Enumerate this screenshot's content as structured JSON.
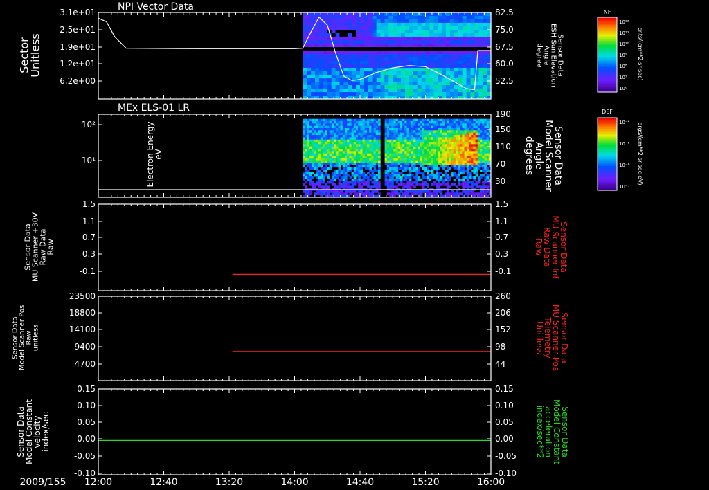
{
  "figure": {
    "date_label": "2009/155",
    "time_axis": {
      "start": "12:00",
      "end": "16:00",
      "tick_labels": [
        "12:00",
        "12:40",
        "13:20",
        "14:00",
        "14:40",
        "15:20",
        "16:00"
      ]
    }
  },
  "colorbars": [
    {
      "tag": "NF",
      "unit": "cnts/(cm**2-sr-sec)",
      "ticks": [
        "10¹²",
        "10¹¹",
        "10¹⁰",
        "10⁹",
        "10⁸",
        "10⁷",
        "10⁶"
      ]
    },
    {
      "tag": "DEF",
      "unit": "ergs/(cm**2-sr-sec-eV)",
      "ticks": [
        "10⁻⁴",
        "10⁻⁵",
        "10⁻⁶",
        "10⁻⁷"
      ]
    }
  ],
  "chart_data": [
    {
      "type": "heatmap",
      "title": "NPI Vector Data",
      "left_axis": {
        "label_lines": [
          "Sector",
          "Unitless"
        ],
        "ticks": [
          "3.1e+01",
          "2.5e+01",
          "1.9e+01",
          "1.2e+01",
          "6.2e+00"
        ],
        "color": "#ffffff"
      },
      "right_axis": {
        "label_lines": [
          "Sensor Data",
          "ESH Sun Elevation",
          "Angle",
          "degree"
        ],
        "ticks": [
          "82.5",
          "75.0",
          "67.5",
          "60.0",
          "52.5"
        ],
        "range": [
          45,
          82.5
        ],
        "color": "#ffffff"
      },
      "heatmap_time_range": [
        "14:05",
        "16:00"
      ],
      "overlay_line": {
        "axis": "right",
        "color": "#ffffff",
        "x": [
          "12:00",
          "12:05",
          "12:10",
          "12:17",
          "13:00",
          "14:00",
          "14:05",
          "14:10",
          "14:15",
          "14:20",
          "14:25",
          "14:30",
          "14:35",
          "14:40",
          "14:50",
          "15:00",
          "15:10",
          "15:20",
          "15:30",
          "15:40",
          "15:45",
          "15:50",
          "15:52",
          "16:00"
        ],
        "y": [
          80.0,
          78.5,
          72.0,
          67.0,
          66.8,
          66.8,
          67.0,
          74.0,
          80.5,
          77.0,
          65.0,
          55.0,
          53.0,
          53.5,
          56.5,
          58.5,
          59.5,
          59.0,
          55.5,
          51.5,
          49.5,
          49.0,
          66.0,
          66.0
        ]
      }
    },
    {
      "type": "heatmap",
      "title": "MEx ELS-01 LR",
      "left_axis": {
        "label_lines": [
          "Electron Energy",
          "eV"
        ],
        "ticks": [
          "10²",
          "10¹"
        ],
        "scale": "log",
        "color": "#ffffff"
      },
      "right_axis": {
        "label_lines": [
          "Sensor Data",
          "Model Scanner",
          "Angle",
          "degrees"
        ],
        "ticks": [
          "190",
          "150",
          "110",
          "70",
          "30"
        ],
        "range": [
          -5,
          190
        ],
        "color": "#ffffff"
      },
      "heatmap_time_range": [
        "14:05",
        "16:00"
      ],
      "overlay_line": {
        "axis": "right",
        "color": "#ffffff",
        "x": [
          "12:00",
          "16:00"
        ],
        "y": [
          0,
          0
        ]
      }
    },
    {
      "type": "line",
      "left_axis": {
        "label_lines": [
          "Sensor Data",
          "MU Scanner +30V",
          "Raw Data",
          "Raw"
        ],
        "ticks": [
          "1.5",
          "1.1",
          "0.7",
          "0.3",
          "-0.1"
        ],
        "range": [
          -0.35,
          1.5
        ],
        "color": "#ffffff"
      },
      "right_axis": {
        "label_lines": [
          "Sensor Data",
          "MU Scanner Inf",
          "Raw Data",
          "Raw"
        ],
        "ticks": [
          "1.5",
          "1.1",
          "0.7",
          "0.3",
          "-0.1"
        ],
        "range": [
          -0.35,
          1.5
        ],
        "color": "#ff2020"
      },
      "series": [
        {
          "axis": "right",
          "color": "#ff2020",
          "x": [
            "13:22",
            "16:00"
          ],
          "y": [
            0.0,
            0.0
          ]
        }
      ]
    },
    {
      "type": "line",
      "left_axis": {
        "label_lines": [
          "Sensor Data",
          "Model Scanner Pos",
          "Raw",
          "unitless"
        ],
        "ticks": [
          "23500",
          "18800",
          "14100",
          "9400",
          "4700"
        ],
        "range": [
          0,
          23500
        ],
        "color": "#ffffff"
      },
      "right_axis": {
        "label_lines": [
          "Sensor Data",
          "MU Scanner Pos",
          "Telemetry",
          "Unitless"
        ],
        "ticks": [
          "260",
          "206",
          "152",
          "98",
          "44"
        ],
        "range": [
          0,
          260
        ],
        "color": "#ff2020"
      },
      "series": [
        {
          "axis": "right",
          "color": "#ff2020",
          "x": [
            "13:22",
            "16:00"
          ],
          "y": [
            90,
            90
          ]
        }
      ]
    },
    {
      "type": "line",
      "left_axis": {
        "label_lines": [
          "Sensor Data",
          "Model Constant",
          "velocity",
          "index/sec"
        ],
        "ticks": [
          "0.15",
          "0.10",
          "0.05",
          "0.00",
          "-0.05",
          "-0.10"
        ],
        "range": [
          -0.1,
          0.15
        ],
        "color": "#ffffff"
      },
      "right_axis": {
        "label_lines": [
          "Sensor Data",
          "Model Constant",
          "acceleration",
          "index/sec**2"
        ],
        "ticks": [
          "0.15",
          "0.10",
          "0.05",
          "0.00",
          "-0.05",
          "-0.10"
        ],
        "range": [
          -0.1,
          0.15
        ],
        "color": "#22dd22"
      },
      "series": [
        {
          "axis": "right",
          "color": "#22dd22",
          "x": [
            "12:00",
            "16:00"
          ],
          "y": [
            0.0,
            0.0
          ]
        }
      ]
    }
  ]
}
